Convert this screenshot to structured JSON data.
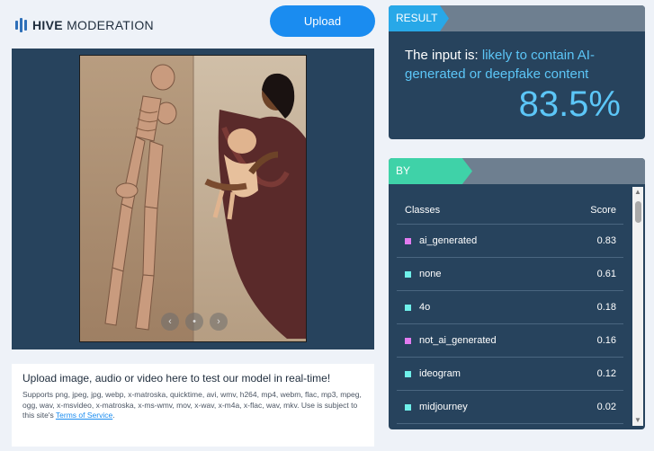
{
  "header": {
    "logo_bold": "HIVE",
    "logo_rest": "MODERATION",
    "upload_label": "Upload"
  },
  "preview": {
    "carousel": {
      "prev_icon": "chevron-left-icon",
      "dot": "•",
      "next_icon": "chevron-right-icon",
      "prev_glyph": "‹",
      "next_glyph": "›"
    }
  },
  "info": {
    "title": "Upload image, audio or video here to test our model in real-time!",
    "supports": "Supports png, jpeg, jpg, webp, x-matroska, quicktime, avi, wmv, h264, mp4, webm, flac, mp3, mpeg, ogg, wav, x-msvideo, x-matroska, x-ms-wmv, mov, x-wav, x-m4a, x-flac, wav, mkv. Use is subject to this site's",
    "tos_link": "Terms of Service",
    "tos_suffix": "."
  },
  "result": {
    "tag": "RESULT",
    "prefix": "The input is: ",
    "verdict": "likely to contain AI-generated or deepfake content",
    "score": "83.5%"
  },
  "classes": {
    "tag": "BY CLASSES",
    "col_class": "Classes",
    "col_score": "Score",
    "rows": [
      {
        "name": "ai_generated",
        "score": "0.83",
        "color": "#e27bf0"
      },
      {
        "name": "none",
        "score": "0.61",
        "color": "#6ff0ea"
      },
      {
        "name": "4o",
        "score": "0.18",
        "color": "#6ff0ea"
      },
      {
        "name": "not_ai_generated",
        "score": "0.16",
        "color": "#e27bf0"
      },
      {
        "name": "ideogram",
        "score": "0.12",
        "color": "#6ff0ea"
      },
      {
        "name": "midjourney",
        "score": "0.02",
        "color": "#6ff0ea"
      }
    ]
  },
  "colors": {
    "accent": "#1a8cf0",
    "panel": "#27435d",
    "highlight": "#5cc6f7"
  }
}
